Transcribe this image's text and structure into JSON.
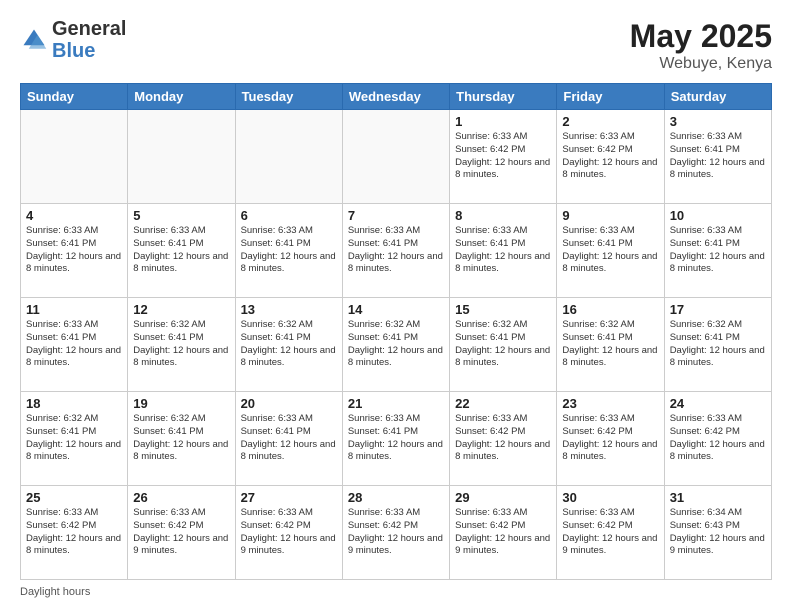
{
  "header": {
    "logo_general": "General",
    "logo_blue": "Blue",
    "title_month": "May 2025",
    "title_location": "Webuye, Kenya"
  },
  "footer": {
    "label": "Daylight hours"
  },
  "days_of_week": [
    "Sunday",
    "Monday",
    "Tuesday",
    "Wednesday",
    "Thursday",
    "Friday",
    "Saturday"
  ],
  "weeks": [
    [
      {
        "day": "",
        "info": ""
      },
      {
        "day": "",
        "info": ""
      },
      {
        "day": "",
        "info": ""
      },
      {
        "day": "",
        "info": ""
      },
      {
        "day": "1",
        "info": "Sunrise: 6:33 AM\nSunset: 6:42 PM\nDaylight: 12 hours and 8 minutes."
      },
      {
        "day": "2",
        "info": "Sunrise: 6:33 AM\nSunset: 6:42 PM\nDaylight: 12 hours and 8 minutes."
      },
      {
        "day": "3",
        "info": "Sunrise: 6:33 AM\nSunset: 6:41 PM\nDaylight: 12 hours and 8 minutes."
      }
    ],
    [
      {
        "day": "4",
        "info": "Sunrise: 6:33 AM\nSunset: 6:41 PM\nDaylight: 12 hours and 8 minutes."
      },
      {
        "day": "5",
        "info": "Sunrise: 6:33 AM\nSunset: 6:41 PM\nDaylight: 12 hours and 8 minutes."
      },
      {
        "day": "6",
        "info": "Sunrise: 6:33 AM\nSunset: 6:41 PM\nDaylight: 12 hours and 8 minutes."
      },
      {
        "day": "7",
        "info": "Sunrise: 6:33 AM\nSunset: 6:41 PM\nDaylight: 12 hours and 8 minutes."
      },
      {
        "day": "8",
        "info": "Sunrise: 6:33 AM\nSunset: 6:41 PM\nDaylight: 12 hours and 8 minutes."
      },
      {
        "day": "9",
        "info": "Sunrise: 6:33 AM\nSunset: 6:41 PM\nDaylight: 12 hours and 8 minutes."
      },
      {
        "day": "10",
        "info": "Sunrise: 6:33 AM\nSunset: 6:41 PM\nDaylight: 12 hours and 8 minutes."
      }
    ],
    [
      {
        "day": "11",
        "info": "Sunrise: 6:33 AM\nSunset: 6:41 PM\nDaylight: 12 hours and 8 minutes."
      },
      {
        "day": "12",
        "info": "Sunrise: 6:32 AM\nSunset: 6:41 PM\nDaylight: 12 hours and 8 minutes."
      },
      {
        "day": "13",
        "info": "Sunrise: 6:32 AM\nSunset: 6:41 PM\nDaylight: 12 hours and 8 minutes."
      },
      {
        "day": "14",
        "info": "Sunrise: 6:32 AM\nSunset: 6:41 PM\nDaylight: 12 hours and 8 minutes."
      },
      {
        "day": "15",
        "info": "Sunrise: 6:32 AM\nSunset: 6:41 PM\nDaylight: 12 hours and 8 minutes."
      },
      {
        "day": "16",
        "info": "Sunrise: 6:32 AM\nSunset: 6:41 PM\nDaylight: 12 hours and 8 minutes."
      },
      {
        "day": "17",
        "info": "Sunrise: 6:32 AM\nSunset: 6:41 PM\nDaylight: 12 hours and 8 minutes."
      }
    ],
    [
      {
        "day": "18",
        "info": "Sunrise: 6:32 AM\nSunset: 6:41 PM\nDaylight: 12 hours and 8 minutes."
      },
      {
        "day": "19",
        "info": "Sunrise: 6:32 AM\nSunset: 6:41 PM\nDaylight: 12 hours and 8 minutes."
      },
      {
        "day": "20",
        "info": "Sunrise: 6:33 AM\nSunset: 6:41 PM\nDaylight: 12 hours and 8 minutes."
      },
      {
        "day": "21",
        "info": "Sunrise: 6:33 AM\nSunset: 6:41 PM\nDaylight: 12 hours and 8 minutes."
      },
      {
        "day": "22",
        "info": "Sunrise: 6:33 AM\nSunset: 6:42 PM\nDaylight: 12 hours and 8 minutes."
      },
      {
        "day": "23",
        "info": "Sunrise: 6:33 AM\nSunset: 6:42 PM\nDaylight: 12 hours and 8 minutes."
      },
      {
        "day": "24",
        "info": "Sunrise: 6:33 AM\nSunset: 6:42 PM\nDaylight: 12 hours and 8 minutes."
      }
    ],
    [
      {
        "day": "25",
        "info": "Sunrise: 6:33 AM\nSunset: 6:42 PM\nDaylight: 12 hours and 8 minutes."
      },
      {
        "day": "26",
        "info": "Sunrise: 6:33 AM\nSunset: 6:42 PM\nDaylight: 12 hours and 9 minutes."
      },
      {
        "day": "27",
        "info": "Sunrise: 6:33 AM\nSunset: 6:42 PM\nDaylight: 12 hours and 9 minutes."
      },
      {
        "day": "28",
        "info": "Sunrise: 6:33 AM\nSunset: 6:42 PM\nDaylight: 12 hours and 9 minutes."
      },
      {
        "day": "29",
        "info": "Sunrise: 6:33 AM\nSunset: 6:42 PM\nDaylight: 12 hours and 9 minutes."
      },
      {
        "day": "30",
        "info": "Sunrise: 6:33 AM\nSunset: 6:42 PM\nDaylight: 12 hours and 9 minutes."
      },
      {
        "day": "31",
        "info": "Sunrise: 6:34 AM\nSunset: 6:43 PM\nDaylight: 12 hours and 9 minutes."
      }
    ]
  ]
}
